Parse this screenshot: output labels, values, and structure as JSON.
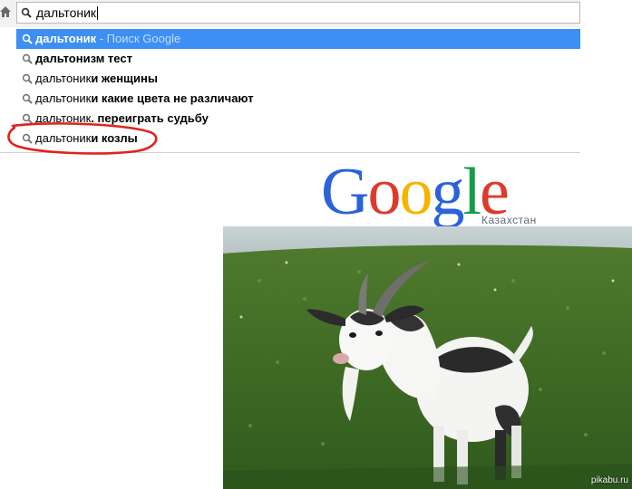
{
  "omnibox": {
    "value": "дальтоник",
    "icon": "search-icon"
  },
  "suggestions": [
    {
      "bold": "дальтоник",
      "normal": "",
      "hint": " - Поиск Google",
      "selected": true
    },
    {
      "bold": "дальтонизм тест",
      "normal": "",
      "hint": "",
      "selected": false
    },
    {
      "normal": "дальтоник",
      "bold": "и женщины",
      "hint": "",
      "selected": false
    },
    {
      "normal": "дальтоник",
      "bold": "и какие цвета не различают",
      "hint": "",
      "selected": false
    },
    {
      "normal": "дальтоник",
      "bold": ". переиграть судьбу",
      "hint": "",
      "selected": false
    },
    {
      "normal": "дальтоник",
      "bold": "и козлы",
      "hint": "",
      "selected": false
    }
  ],
  "google": {
    "letters": [
      "G",
      "o",
      "o",
      "g",
      "l",
      "e"
    ],
    "colors": [
      "#2a62d9",
      "#dd3a2b",
      "#f4b400",
      "#2a62d9",
      "#179c49",
      "#dd3a2b"
    ],
    "region": "Казахстан"
  },
  "photo": {
    "watermark": "pikabu.ru"
  },
  "colors": {
    "selected_bg": "#3d8ff3",
    "annotation": "#e0231d"
  }
}
